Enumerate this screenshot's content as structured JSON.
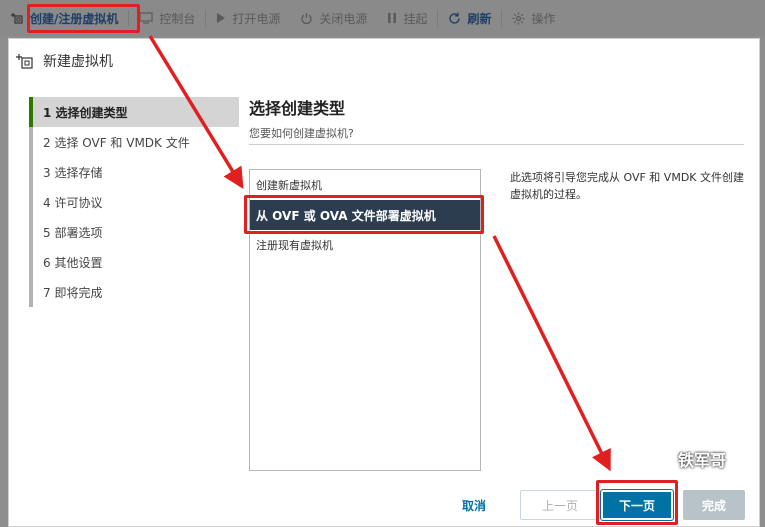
{
  "toolbar": {
    "create": "创建/注册虚拟机",
    "console": "控制台",
    "power_on": "打开电源",
    "power_off": "关闭电源",
    "suspend": "挂起",
    "refresh": "刷新",
    "actions": "操作"
  },
  "dialog": {
    "title": "新建虚拟机",
    "steps": [
      {
        "label": "1  选择创建类型"
      },
      {
        "label": "2  选择 OVF 和 VMDK 文件"
      },
      {
        "label": "3  选择存储"
      },
      {
        "label": "4  许可协议"
      },
      {
        "label": "5  部署选项"
      },
      {
        "label": "6  其他设置"
      },
      {
        "label": "7  即将完成"
      }
    ],
    "main_title": "选择创建类型",
    "main_subtitle": "您要如何创建虚拟机?",
    "options": [
      {
        "label": "创建新虚拟机"
      },
      {
        "label": "从 OVF 或 OVA 文件部署虚拟机"
      },
      {
        "label": "注册现有虚拟机"
      }
    ],
    "description": "此选项将引导您完成从 OVF 和 VMDK 文件创建虚拟机的过程。",
    "buttons": {
      "cancel": "取消",
      "prev": "上一页",
      "next": "下一页",
      "finish": "完成"
    }
  },
  "watermark": "铁军哥",
  "colors": {
    "accent": "#0072a3",
    "selected_bg": "#2c3d4f",
    "highlight": "#e02020",
    "step_active_bar": "#307700"
  }
}
